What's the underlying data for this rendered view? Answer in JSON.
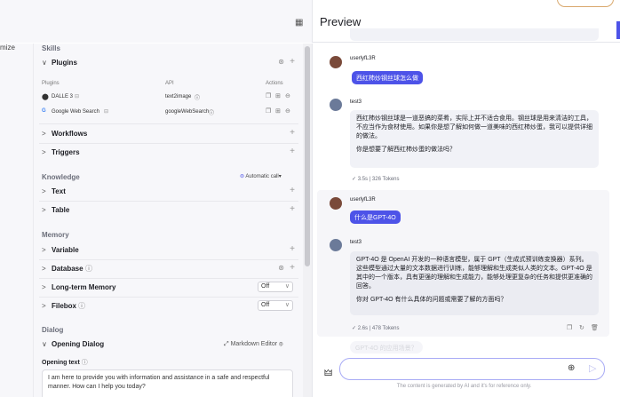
{
  "header": {
    "preview_title": "Preview",
    "left_partial_label": "mize"
  },
  "skills": {
    "title": "Skills",
    "plugins": {
      "label": "Plugins",
      "col_plugins": "Plugins",
      "col_api": "API",
      "col_actions": "Actions",
      "rows": [
        {
          "name": "DALLE 3",
          "api": "text2image"
        },
        {
          "name": "Google Web Search",
          "api": "googleWebSearch"
        }
      ]
    },
    "workflows": "Workflows",
    "triggers": "Triggers"
  },
  "knowledge": {
    "title": "Knowledge",
    "auto_call": "Automatic call",
    "text": "Text",
    "table": "Table"
  },
  "memory": {
    "title": "Memory",
    "variable": "Variable",
    "database": "Database",
    "long_term": "Long-term Memory",
    "long_term_value": "Off",
    "filebox": "Filebox",
    "filebox_value": "Off"
  },
  "dialog": {
    "title": "Dialog",
    "opening": "Opening Dialog",
    "markdown_editor": "Markdown Editor",
    "opening_text_label": "Opening text",
    "opening_text": "I am here to provide you with information and assistance in a safe and respectful manner. How can I help you today?"
  },
  "chat": {
    "messages": [
      {
        "role": "user",
        "name": "userlyfL3R",
        "text": "西红柿炒钢丝球怎么做"
      },
      {
        "role": "bot",
        "name": "test3",
        "text": "西红柿炒钢丝球是一道恶搞的菜肴，实际上并不适合食用。钢丝球是用来清洁的工具，不应当作为食材使用。如果你是想了解如何做一道美味的西红柿炒蛋，我可以提供详细的做法。",
        "text2": "你是想要了解西红柿炒蛋的做法吗？",
        "meta": "3.5s | 326 Tokens"
      },
      {
        "role": "user",
        "name": "userlyfL3R",
        "text": "什么是GPT-4O"
      },
      {
        "role": "bot",
        "name": "test3",
        "text": "GPT-4O 是 OpenAI 开发的一种语言模型，属于 GPT（生成式预训练变换器）系列。这些模型通过大量的文本数据进行训练，能够理解和生成类似人类的文本。GPT-4O 是其中的一个版本，具有更强的理解和生成能力，能够处理更复杂的任务和提供更准确的回答。",
        "text2": "你对 GPT-4O 有什么具体的问题或需要了解的方面吗？",
        "meta": "2.6s | 478 Tokens"
      }
    ],
    "suggestion": "GPT-4O 的应用场景？",
    "input_placeholder": "",
    "footer": "The content is generated by AI and it's for reference only."
  },
  "colors": {
    "accent": "#4d53e8",
    "bg": "#f7f7fa"
  }
}
